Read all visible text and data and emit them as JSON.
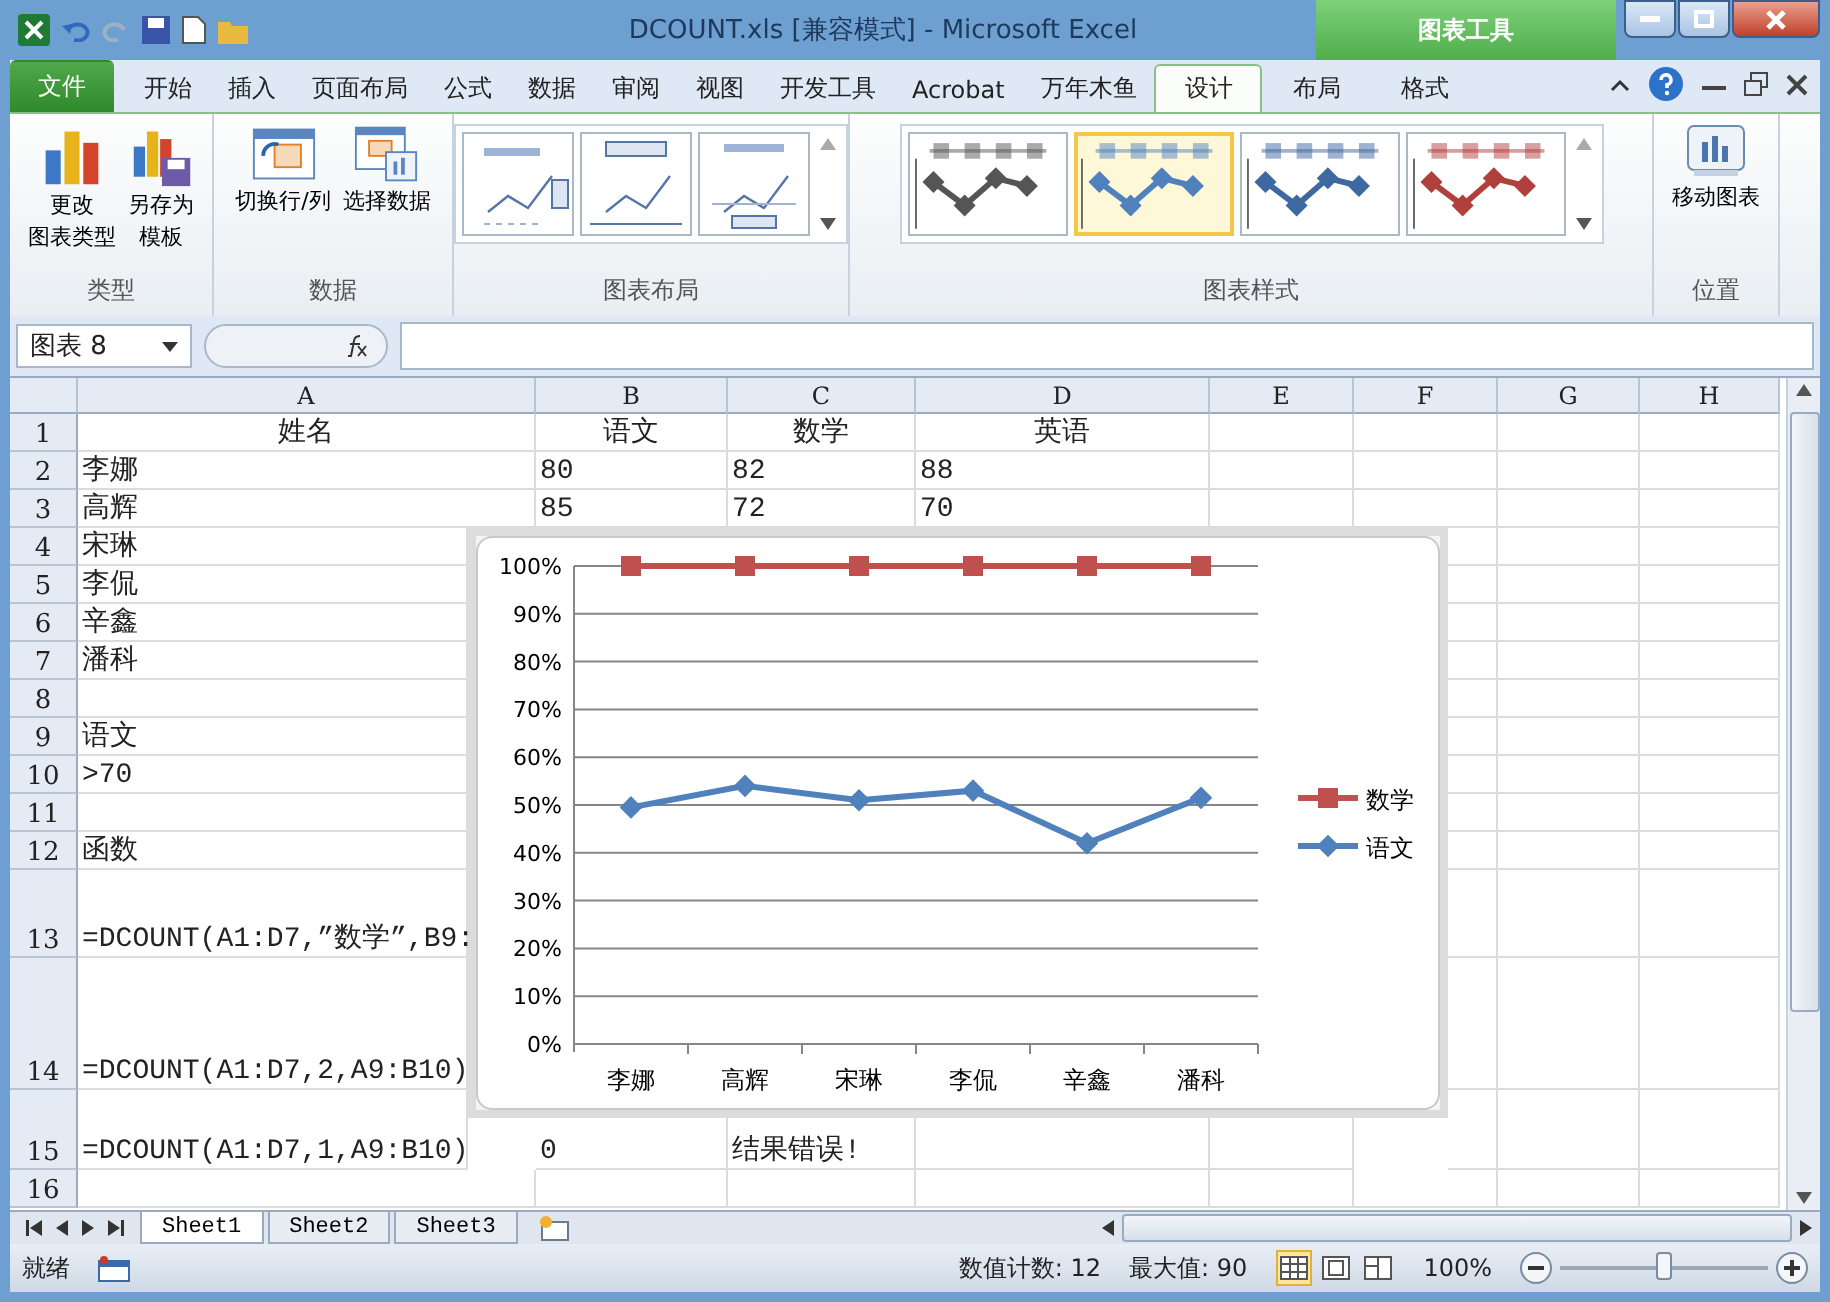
{
  "window": {
    "title": "DCOUNT.xls  [兼容模式]  -  Microsoft Excel",
    "tool_group": "图表工具"
  },
  "ribbon_tabs": [
    {
      "label": "文件",
      "kind": "file",
      "selected": false
    },
    {
      "label": "开始",
      "kind": "main",
      "selected": false
    },
    {
      "label": "插入",
      "kind": "main",
      "selected": false
    },
    {
      "label": "页面布局",
      "kind": "main",
      "selected": false
    },
    {
      "label": "公式",
      "kind": "main",
      "selected": false
    },
    {
      "label": "数据",
      "kind": "main",
      "selected": false
    },
    {
      "label": "审阅",
      "kind": "main",
      "selected": false
    },
    {
      "label": "视图",
      "kind": "main",
      "selected": false
    },
    {
      "label": "开发工具",
      "kind": "main",
      "selected": false
    },
    {
      "label": "Acrobat",
      "kind": "main",
      "selected": false
    },
    {
      "label": "万年木鱼",
      "kind": "main",
      "selected": false
    },
    {
      "label": "设计",
      "kind": "tool",
      "selected": true
    },
    {
      "label": "布局",
      "kind": "tool",
      "selected": false
    },
    {
      "label": "格式",
      "kind": "tool",
      "selected": false
    }
  ],
  "ribbon_groups": [
    {
      "label": "类型",
      "kind": "buttons",
      "buttons": [
        {
          "lines": [
            "更改",
            "图表类型"
          ],
          "kind": "chart"
        },
        {
          "lines": [
            "另存为",
            "模板"
          ],
          "kind": "template"
        }
      ]
    },
    {
      "label": "数据",
      "kind": "buttons",
      "buttons": [
        {
          "lines": [
            "切换行/列"
          ],
          "kind": "switch"
        },
        {
          "lines": [
            "选择数据"
          ],
          "kind": "select"
        }
      ]
    },
    {
      "label": "图表布局",
      "kind": "layouts",
      "layouts": [
        {
          "kind": "legend-right"
        },
        {
          "kind": "data-labels"
        },
        {
          "kind": "legend-bottom"
        }
      ]
    },
    {
      "label": "图表样式",
      "kind": "styles",
      "styles": [
        {
          "color": "#555555",
          "selected": false
        },
        {
          "color": "#4f81bd",
          "selected": true
        },
        {
          "color": "#3d68a0",
          "selected": false
        },
        {
          "color": "#b0403c",
          "selected": false
        }
      ]
    },
    {
      "label": "位置",
      "kind": "buttons",
      "buttons": [
        {
          "lines": [
            "移动图表"
          ],
          "kind": "move"
        }
      ]
    }
  ],
  "formula_bar": {
    "name_box": "图表 8"
  },
  "sheet": {
    "columns": [
      "A",
      "B",
      "C",
      "D",
      "E",
      "F",
      "G",
      "H"
    ],
    "rows": [
      {
        "header": "1",
        "cells": {
          "A": "姓名",
          "B": "语文",
          "C": "数学",
          "D": "英语"
        }
      },
      {
        "header": "2",
        "cells": {
          "A": "李娜",
          "B": "80",
          "C": "82",
          "D": "88"
        }
      },
      {
        "header": "3",
        "cells": {
          "A": "高辉",
          "B": "85",
          "C": "72",
          "D": "70"
        }
      },
      {
        "header": "4",
        "cells": {
          "A": "宋琳"
        }
      },
      {
        "header": "5",
        "cells": {
          "A": "李侃"
        }
      },
      {
        "header": "6",
        "cells": {
          "A": "辛鑫"
        }
      },
      {
        "header": "7",
        "cells": {
          "A": "潘科"
        }
      },
      {
        "header": "8",
        "cells": {}
      },
      {
        "header": "9",
        "cells": {
          "A": "语文"
        }
      },
      {
        "header": "10",
        "cells": {
          "A": ">70"
        }
      },
      {
        "header": "11",
        "cells": {}
      },
      {
        "header": "12",
        "cells": {
          "A": "函数"
        }
      },
      {
        "header": "13",
        "cells": {
          "A": "=DCOUNT(A1:D7,”数学”,B9:"
        }
      },
      {
        "header": "14",
        "cells": {
          "A": "=DCOUNT(A1:D7,2,A9:B10)"
        }
      },
      {
        "header": "15",
        "cells": {
          "A": "=DCOUNT(A1:D7,1,A9:B10)",
          "B": "0",
          "C": "结果错误!"
        }
      },
      {
        "header": "16",
        "cells": {}
      }
    ]
  },
  "chart": {
    "chart_data": {
      "type": "line",
      "categories": [
        "李娜",
        "高辉",
        "宋琳",
        "李侃",
        "辛鑫",
        "潘科"
      ],
      "series": [
        {
          "name": "数学",
          "color": "#c0504d",
          "marker": "square",
          "values": [
            1,
            1,
            1,
            1,
            1,
            1
          ]
        },
        {
          "name": "语文",
          "color": "#4f81bd",
          "marker": "diamond",
          "values": [
            0.495,
            0.54,
            0.51,
            0.53,
            0.42,
            0.515
          ]
        }
      ],
      "ylim": [
        0,
        1
      ],
      "yticks": [
        {
          "value": 0,
          "label": "0%"
        },
        {
          "value": 0.1,
          "label": "10%"
        },
        {
          "value": 0.2,
          "label": "20%"
        },
        {
          "value": 0.3,
          "label": "30%"
        },
        {
          "value": 0.4,
          "label": "40%"
        },
        {
          "value": 0.5,
          "label": "50%"
        },
        {
          "value": 0.6,
          "label": "60%"
        },
        {
          "value": 0.7,
          "label": "70%"
        },
        {
          "value": 0.8,
          "label": "80%"
        },
        {
          "value": 0.9,
          "label": "90%"
        },
        {
          "value": 1,
          "label": "100%"
        }
      ],
      "grid": true,
      "legend": true
    }
  },
  "sheet_tabs": [
    {
      "label": "Sheet1",
      "selected": true
    },
    {
      "label": "Sheet2",
      "selected": false
    },
    {
      "label": "Sheet3",
      "selected": false
    }
  ],
  "status_bar": {
    "status": "就绪",
    "count": "数值计数: 12",
    "max": "最大值: 90",
    "zoom": "100%",
    "views": [
      {
        "kind": "normal",
        "selected": true
      },
      {
        "kind": "page-layout",
        "selected": false
      },
      {
        "kind": "page-break",
        "selected": false
      }
    ],
    "zoom_slider": {
      "level": 0.5
    }
  }
}
